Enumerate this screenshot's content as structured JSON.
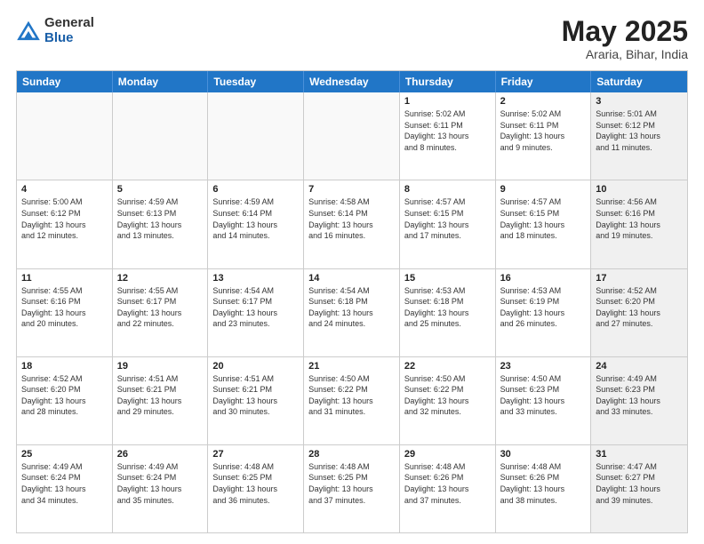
{
  "header": {
    "logo_general": "General",
    "logo_blue": "Blue",
    "title_month": "May 2025",
    "title_location": "Araria, Bihar, India"
  },
  "weekdays": [
    "Sunday",
    "Monday",
    "Tuesday",
    "Wednesday",
    "Thursday",
    "Friday",
    "Saturday"
  ],
  "rows": [
    [
      {
        "day": "",
        "info": "",
        "empty": true
      },
      {
        "day": "",
        "info": "",
        "empty": true
      },
      {
        "day": "",
        "info": "",
        "empty": true
      },
      {
        "day": "",
        "info": "",
        "empty": true
      },
      {
        "day": "1",
        "info": "Sunrise: 5:02 AM\nSunset: 6:11 PM\nDaylight: 13 hours\nand 8 minutes.",
        "empty": false
      },
      {
        "day": "2",
        "info": "Sunrise: 5:02 AM\nSunset: 6:11 PM\nDaylight: 13 hours\nand 9 minutes.",
        "empty": false
      },
      {
        "day": "3",
        "info": "Sunrise: 5:01 AM\nSunset: 6:12 PM\nDaylight: 13 hours\nand 11 minutes.",
        "empty": false,
        "shaded": true
      }
    ],
    [
      {
        "day": "4",
        "info": "Sunrise: 5:00 AM\nSunset: 6:12 PM\nDaylight: 13 hours\nand 12 minutes.",
        "empty": false
      },
      {
        "day": "5",
        "info": "Sunrise: 4:59 AM\nSunset: 6:13 PM\nDaylight: 13 hours\nand 13 minutes.",
        "empty": false
      },
      {
        "day": "6",
        "info": "Sunrise: 4:59 AM\nSunset: 6:14 PM\nDaylight: 13 hours\nand 14 minutes.",
        "empty": false
      },
      {
        "day": "7",
        "info": "Sunrise: 4:58 AM\nSunset: 6:14 PM\nDaylight: 13 hours\nand 16 minutes.",
        "empty": false
      },
      {
        "day": "8",
        "info": "Sunrise: 4:57 AM\nSunset: 6:15 PM\nDaylight: 13 hours\nand 17 minutes.",
        "empty": false
      },
      {
        "day": "9",
        "info": "Sunrise: 4:57 AM\nSunset: 6:15 PM\nDaylight: 13 hours\nand 18 minutes.",
        "empty": false
      },
      {
        "day": "10",
        "info": "Sunrise: 4:56 AM\nSunset: 6:16 PM\nDaylight: 13 hours\nand 19 minutes.",
        "empty": false,
        "shaded": true
      }
    ],
    [
      {
        "day": "11",
        "info": "Sunrise: 4:55 AM\nSunset: 6:16 PM\nDaylight: 13 hours\nand 20 minutes.",
        "empty": false
      },
      {
        "day": "12",
        "info": "Sunrise: 4:55 AM\nSunset: 6:17 PM\nDaylight: 13 hours\nand 22 minutes.",
        "empty": false
      },
      {
        "day": "13",
        "info": "Sunrise: 4:54 AM\nSunset: 6:17 PM\nDaylight: 13 hours\nand 23 minutes.",
        "empty": false
      },
      {
        "day": "14",
        "info": "Sunrise: 4:54 AM\nSunset: 6:18 PM\nDaylight: 13 hours\nand 24 minutes.",
        "empty": false
      },
      {
        "day": "15",
        "info": "Sunrise: 4:53 AM\nSunset: 6:18 PM\nDaylight: 13 hours\nand 25 minutes.",
        "empty": false
      },
      {
        "day": "16",
        "info": "Sunrise: 4:53 AM\nSunset: 6:19 PM\nDaylight: 13 hours\nand 26 minutes.",
        "empty": false
      },
      {
        "day": "17",
        "info": "Sunrise: 4:52 AM\nSunset: 6:20 PM\nDaylight: 13 hours\nand 27 minutes.",
        "empty": false,
        "shaded": true
      }
    ],
    [
      {
        "day": "18",
        "info": "Sunrise: 4:52 AM\nSunset: 6:20 PM\nDaylight: 13 hours\nand 28 minutes.",
        "empty": false
      },
      {
        "day": "19",
        "info": "Sunrise: 4:51 AM\nSunset: 6:21 PM\nDaylight: 13 hours\nand 29 minutes.",
        "empty": false
      },
      {
        "day": "20",
        "info": "Sunrise: 4:51 AM\nSunset: 6:21 PM\nDaylight: 13 hours\nand 30 minutes.",
        "empty": false
      },
      {
        "day": "21",
        "info": "Sunrise: 4:50 AM\nSunset: 6:22 PM\nDaylight: 13 hours\nand 31 minutes.",
        "empty": false
      },
      {
        "day": "22",
        "info": "Sunrise: 4:50 AM\nSunset: 6:22 PM\nDaylight: 13 hours\nand 32 minutes.",
        "empty": false
      },
      {
        "day": "23",
        "info": "Sunrise: 4:50 AM\nSunset: 6:23 PM\nDaylight: 13 hours\nand 33 minutes.",
        "empty": false
      },
      {
        "day": "24",
        "info": "Sunrise: 4:49 AM\nSunset: 6:23 PM\nDaylight: 13 hours\nand 33 minutes.",
        "empty": false,
        "shaded": true
      }
    ],
    [
      {
        "day": "25",
        "info": "Sunrise: 4:49 AM\nSunset: 6:24 PM\nDaylight: 13 hours\nand 34 minutes.",
        "empty": false
      },
      {
        "day": "26",
        "info": "Sunrise: 4:49 AM\nSunset: 6:24 PM\nDaylight: 13 hours\nand 35 minutes.",
        "empty": false
      },
      {
        "day": "27",
        "info": "Sunrise: 4:48 AM\nSunset: 6:25 PM\nDaylight: 13 hours\nand 36 minutes.",
        "empty": false
      },
      {
        "day": "28",
        "info": "Sunrise: 4:48 AM\nSunset: 6:25 PM\nDaylight: 13 hours\nand 37 minutes.",
        "empty": false
      },
      {
        "day": "29",
        "info": "Sunrise: 4:48 AM\nSunset: 6:26 PM\nDaylight: 13 hours\nand 37 minutes.",
        "empty": false
      },
      {
        "day": "30",
        "info": "Sunrise: 4:48 AM\nSunset: 6:26 PM\nDaylight: 13 hours\nand 38 minutes.",
        "empty": false
      },
      {
        "day": "31",
        "info": "Sunrise: 4:47 AM\nSunset: 6:27 PM\nDaylight: 13 hours\nand 39 minutes.",
        "empty": false,
        "shaded": true
      }
    ]
  ]
}
